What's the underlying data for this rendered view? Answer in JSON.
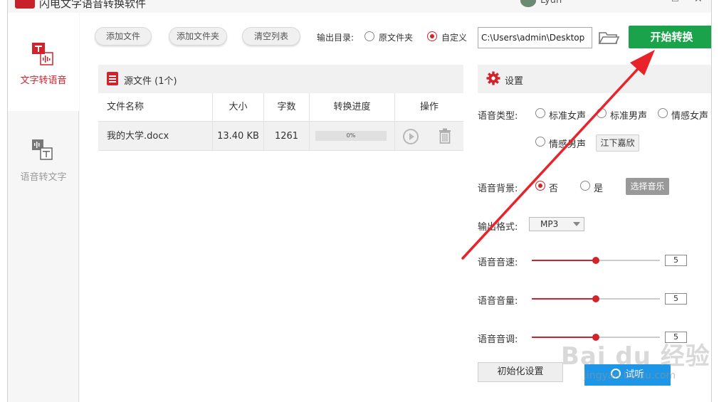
{
  "app": {
    "title": "闪电文字语音转换软件",
    "user_name": "Lyun",
    "window_controls": {
      "minimize": "—",
      "maximize": "☐",
      "close": "✕"
    }
  },
  "sidebar": {
    "items": [
      {
        "label": "文字转语音",
        "icon": "text-to-speech-icon",
        "active": true
      },
      {
        "label": "语音转文字",
        "icon": "speech-to-text-icon",
        "active": false
      }
    ]
  },
  "toolbar": {
    "add_file": "添加文件",
    "add_folder": "添加文件夹",
    "clear_list": "清空列表",
    "output_dir_label": "输出目录:",
    "output_options": [
      "原文件夹",
      "自定义"
    ],
    "output_selected": "自定义",
    "output_path": "C:\\Users\\admin\\Desktop",
    "folder_icon": "folder-icon",
    "start_button": "开始转换"
  },
  "files": {
    "title": "源文件 (1个)",
    "columns": [
      "文件名称",
      "大小",
      "字数",
      "转换进度",
      "操作"
    ],
    "rows": [
      {
        "name": "我的大学.docx",
        "size": "13.40 KB",
        "chars": "1261",
        "progress_text": "0%",
        "progress": 0
      }
    ]
  },
  "settings": {
    "title": "设置",
    "voice_type_label": "语音类型:",
    "voice_types": [
      "标准女声",
      "标准男声",
      "情感女声",
      "情感男声"
    ],
    "voice_selected": null,
    "voice_name_button": "江下嘉欣",
    "background_label": "语音背景:",
    "background_options": [
      "否",
      "是"
    ],
    "background_selected": "否",
    "choose_music": "选择音乐",
    "format_label": "输出格式:",
    "format_value": "MP3",
    "speed_label": "语音音速:",
    "speed_value": "5",
    "volume_label": "语音音量:",
    "volume_value": "5",
    "pitch_label": "语音音调:",
    "pitch_value": "5",
    "slider_max": 10,
    "reset_button": "初始化设置",
    "listen_button": "试听"
  },
  "watermark": {
    "main": "Bai du 经验",
    "sub": "jingyan.baidu.com"
  },
  "colors": {
    "accent_red": "#d2232a",
    "start_green": "#1aa34a",
    "listen_blue": "#1e96e8",
    "annotation_arrow": "#e8232a"
  }
}
